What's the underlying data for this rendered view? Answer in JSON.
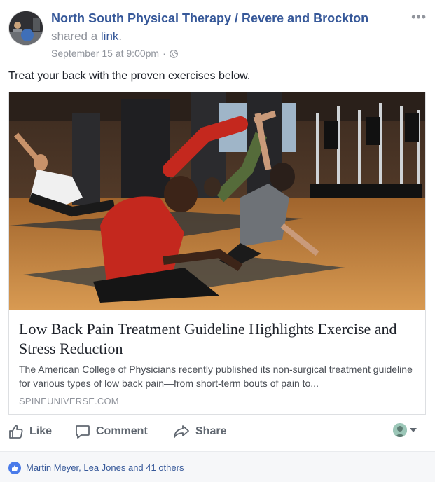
{
  "post": {
    "author": "North South Physical Therapy / Revere and Brockton",
    "action_prefix": "shared a",
    "action_link": "link",
    "action_suffix": ".",
    "timestamp": "September 15 at 9:00pm",
    "separator": "·",
    "privacy_icon": "globe-icon",
    "more_label": "•••",
    "text": "Treat your back with the proven exercises below."
  },
  "link_card": {
    "title": "Low Back Pain Treatment Guideline Highlights Exercise and Stress Reduction",
    "description": "The American College of Physicians recently published its non-surgical treatment guideline for various types of low back pain—from short-term bouts of pain to...",
    "domain": "SPINEUNIVERSE.COM"
  },
  "actions": {
    "like": "Like",
    "comment": "Comment",
    "share": "Share"
  },
  "reactions": {
    "summary": "Martin Meyer, Lea Jones and 41 others"
  },
  "colors": {
    "link_blue": "#365899",
    "secondary_gray": "#90949c",
    "action_gray": "#606770",
    "like_blue": "#4a7bea"
  }
}
